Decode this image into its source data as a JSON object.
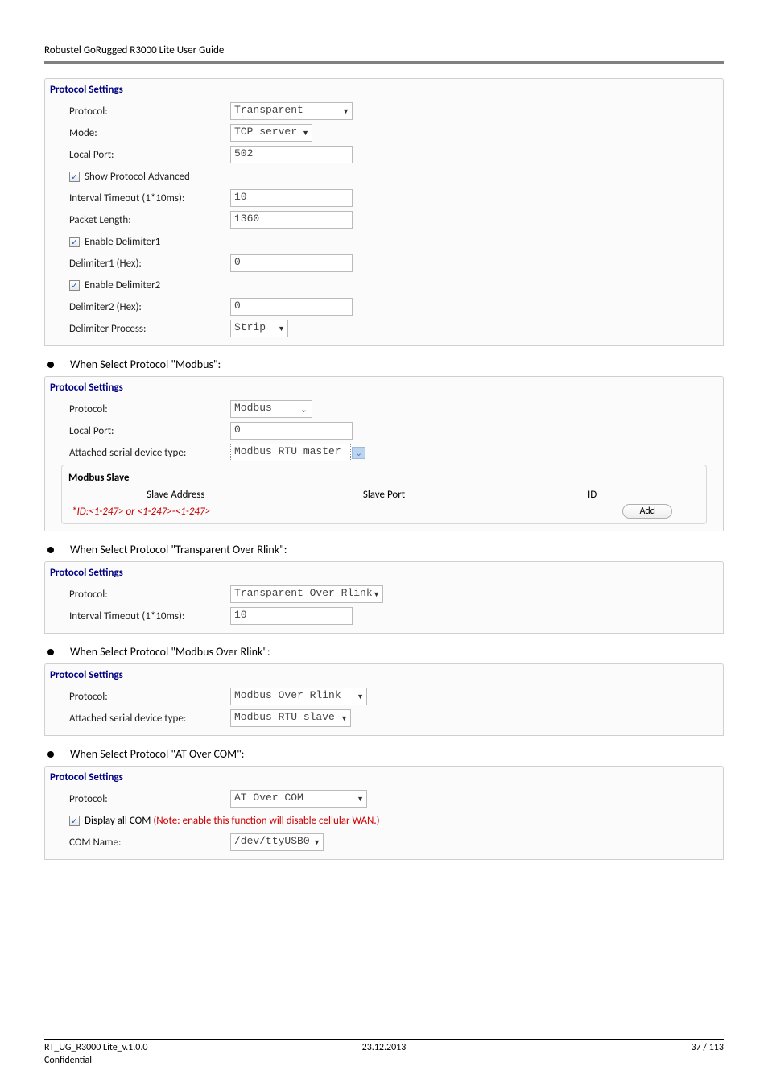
{
  "doc_header": "Robustel GoRugged R3000 Lite User Guide",
  "panel1": {
    "title": "Protocol Settings",
    "protocol_label": "Protocol:",
    "protocol_value": "Transparent",
    "mode_label": "Mode:",
    "mode_value": "TCP server",
    "localport_label": "Local Port:",
    "localport_value": "502",
    "show_adv_label": "Show Protocol Advanced",
    "interval_label": "Interval Timeout (1*10ms):",
    "interval_value": "10",
    "packet_label": "Packet Length:",
    "packet_value": "1360",
    "en_d1_label": "Enable Delimiter1",
    "d1_label": "Delimiter1 (Hex):",
    "d1_value": "0",
    "en_d2_label": "Enable Delimiter2",
    "d2_label": "Delimiter2 (Hex):",
    "d2_value": "0",
    "dp_label": "Delimiter Process:",
    "dp_value": "Strip"
  },
  "bullet_modbus": "When Select Protocol \"Modbus\":",
  "panel2": {
    "title": "Protocol Settings",
    "protocol_label": "Protocol:",
    "protocol_value": "Modbus",
    "localport_label": "Local Port:",
    "localport_value": "0",
    "attached_label": "Attached serial device type:",
    "attached_value": "Modbus RTU master",
    "slave_title": "Modbus Slave",
    "col1": "Slave Address",
    "col2": "Slave Port",
    "col3": "ID",
    "hint": "*ID:<1-247> or <1-247>-<1-247>",
    "add_btn": "Add"
  },
  "bullet_tor": "When Select Protocol \"Transparent Over Rlink\":",
  "panel3": {
    "title": "Protocol Settings",
    "protocol_label": "Protocol:",
    "protocol_value": "Transparent Over Rlink",
    "interval_label": "Interval Timeout (1*10ms):",
    "interval_value": "10"
  },
  "bullet_mor": "When Select Protocol \"Modbus Over Rlink\":",
  "panel4": {
    "title": "Protocol Settings",
    "protocol_label": "Protocol:",
    "protocol_value": "Modbus Over Rlink",
    "attached_label": "Attached serial device type:",
    "attached_value": "Modbus RTU slave"
  },
  "bullet_at": "When Select Protocol \"AT Over COM\":",
  "panel5": {
    "title": "Protocol Settings",
    "protocol_label": "Protocol:",
    "protocol_value": "AT Over COM",
    "display_label": "Display all COM",
    "display_note": " (Note: enable this function will disable cellular WAN.)",
    "com_label": "COM Name:",
    "com_value": "/dev/ttyUSB0"
  },
  "footer": {
    "left1": "RT_UG_R3000 Lite_v.1.0.0",
    "left2": "Confidential",
    "center": "23.12.2013",
    "right": "37 / 113"
  }
}
